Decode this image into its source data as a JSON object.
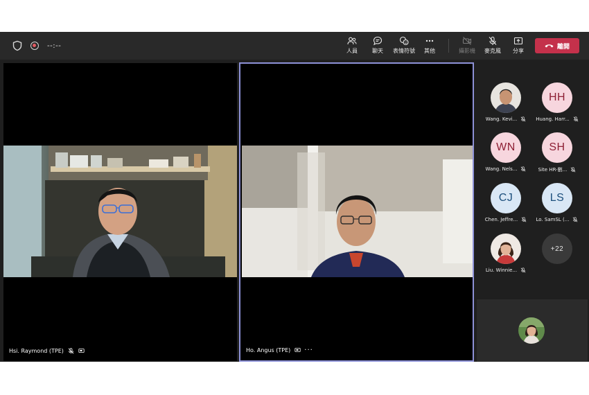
{
  "meeting": {
    "timer": "--:--",
    "toolbar": {
      "people_label": "人員",
      "chat_label": "聊天",
      "reactions_label": "表情符號",
      "more_label": "其他",
      "camera_label": "攝影機",
      "mic_label": "麥克風",
      "share_label": "分享",
      "leave_label": "離開"
    }
  },
  "tiles": [
    {
      "name": "Hsi. Raymond (TPE)"
    },
    {
      "name": "Ho. Angus (TPE)",
      "more": "···"
    }
  ],
  "participants": [
    {
      "initials": "",
      "name": "Wang. Kevi...",
      "avatar": "photo"
    },
    {
      "initials": "HH",
      "name": "Huang. Harr...",
      "avatar": "pink"
    },
    {
      "initials": "WN",
      "name": "Wang. Nels...",
      "avatar": "pink"
    },
    {
      "initials": "SH",
      "name": "Site HR-劉...",
      "avatar": "pink"
    },
    {
      "initials": "CJ",
      "name": "Chen. Jeffre...",
      "avatar": "blue"
    },
    {
      "initials": "LS",
      "name": "Lo. SamSL (...",
      "avatar": "blue"
    },
    {
      "initials": "",
      "name": "Liu. Winnie...",
      "avatar": "photo"
    },
    {
      "initials": "+22",
      "name": "",
      "avatar": "more"
    }
  ],
  "colors": {
    "accent": "#8e92d8",
    "leave": "#c4314b",
    "background": "#1f1f1f",
    "toolbar": "#292929"
  },
  "icons": [
    "shield-icon",
    "record-icon",
    "people-icon",
    "chat-icon",
    "reactions-icon",
    "more-icon",
    "camera-off-icon",
    "mic-off-icon",
    "share-icon",
    "phone-icon"
  ]
}
